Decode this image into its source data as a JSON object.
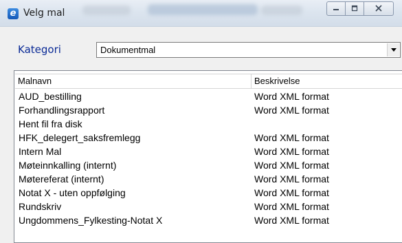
{
  "window": {
    "title": "Velg mal"
  },
  "category": {
    "label": "Kategori",
    "selected": "Dokumentmal"
  },
  "list": {
    "columns": [
      "Malnavn",
      "Beskrivelse"
    ],
    "rows": [
      {
        "name": "AUD_bestilling",
        "description": "Word XML format"
      },
      {
        "name": "Forhandlingsrapport",
        "description": "Word XML format"
      },
      {
        "name": "Hent fil fra disk",
        "description": ""
      },
      {
        "name": "HFK_delegert_saksfremlegg",
        "description": "Word XML format"
      },
      {
        "name": "Intern Mal",
        "description": "Word XML format"
      },
      {
        "name": "Møteinnkalling (internt)",
        "description": "Word XML format"
      },
      {
        "name": "Møtereferat (internt)",
        "description": "Word XML format"
      },
      {
        "name": "Notat  X - uten oppfølging",
        "description": "Word XML format"
      },
      {
        "name": "Rundskriv",
        "description": "Word XML format"
      },
      {
        "name": "Ungdommens_Fylkesting-Notat X",
        "description": "Word XML format"
      }
    ]
  },
  "icons": {
    "app": "app-e-icon",
    "minimize": "minimize-icon",
    "maximize": "maximize-icon",
    "close": "close-icon",
    "dropdown": "chevron-down-icon"
  },
  "colors": {
    "category_label": "#0a2a96",
    "app_icon": "#1f6fd0"
  }
}
